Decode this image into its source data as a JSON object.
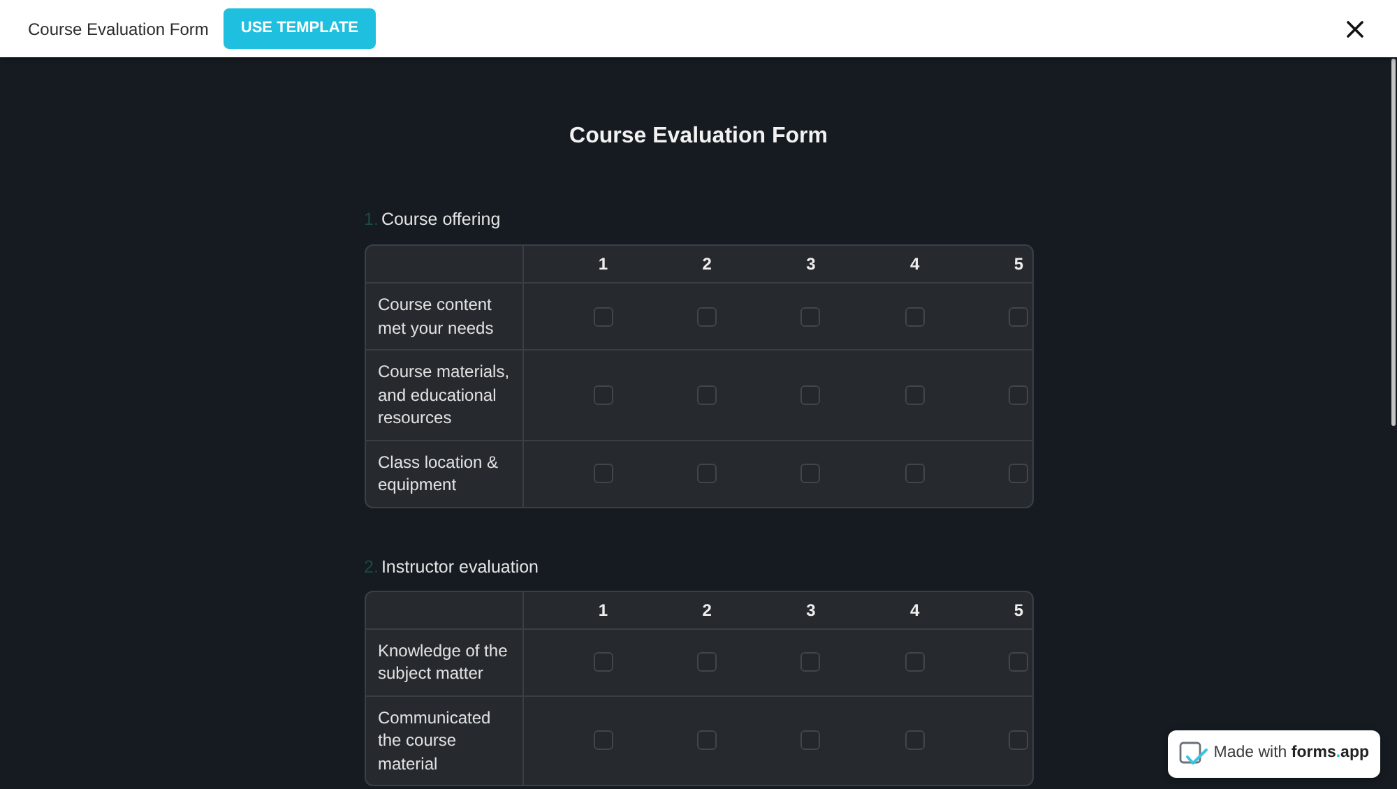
{
  "top_bar": {
    "title": "Course Evaluation Form",
    "button": "USE TEMPLATE"
  },
  "form": {
    "title": "Course Evaluation Form",
    "questions": [
      {
        "number": "1.",
        "label": "Course offering",
        "columns": [
          "1",
          "2",
          "3",
          "4",
          "5"
        ],
        "rows": [
          {
            "label": "Course content met your needs",
            "checked": [
              false,
              false,
              false,
              false,
              false
            ]
          },
          {
            "label": "Course materials, and educational resources",
            "checked": [
              false,
              false,
              false,
              false,
              false
            ]
          },
          {
            "label": "Class location & equipment",
            "checked": [
              false,
              false,
              false,
              false,
              false
            ]
          }
        ]
      },
      {
        "number": "2.",
        "label": "Instructor evaluation",
        "columns": [
          "1",
          "2",
          "3",
          "4",
          "5"
        ],
        "rows": [
          {
            "label": "Knowledge of the subject matter",
            "checked": [
              false,
              false,
              false,
              false,
              false
            ]
          },
          {
            "label": "Communicated the course material",
            "checked": [
              false,
              false,
              false,
              false,
              false
            ]
          }
        ]
      }
    ]
  },
  "badge": {
    "text": "Made with",
    "brand": [
      {
        "text": "forms",
        "accent": false
      },
      {
        "text": ".",
        "accent": true
      },
      {
        "text": "app",
        "accent": false
      }
    ]
  }
}
